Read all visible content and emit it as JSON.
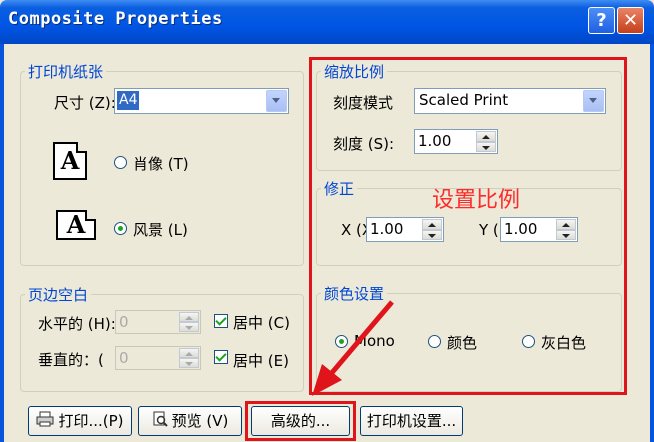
{
  "window": {
    "title": "Composite Properties",
    "help_label": "?",
    "close_label": "✕"
  },
  "paper": {
    "legend": "打印机纸张",
    "size_label": "尺寸 (Z):",
    "size_value": "A4",
    "portrait_label": "肖像 (T)",
    "landscape_label": "风景 (L)",
    "page_letter": "A",
    "selected_orientation": "landscape"
  },
  "margins": {
    "legend": "页边空白",
    "horizontal_label": "水平的 (H):",
    "horizontal_value": "0",
    "vertical_label": "垂直的：(",
    "vertical_value": "0",
    "center_h_label": "居中 (C)",
    "center_v_label": "居中 (E)",
    "center_h_checked": true,
    "center_v_checked": true
  },
  "scale": {
    "legend": "缩放比例",
    "mode_label": "刻度模式",
    "mode_value": "Scaled Print",
    "scale_label": "刻度 (S):",
    "scale_value": "1.00"
  },
  "correction": {
    "legend": "修正",
    "x_label": "X (X",
    "x_value": "1.00",
    "y_label": "Y (",
    "y_value": "1.00"
  },
  "color": {
    "legend": "颜色设置",
    "options": [
      "Mono",
      "颜色",
      "灰白色"
    ],
    "selected": "Mono"
  },
  "buttons": {
    "print": "打印...(P)",
    "preview": "预览 (V)",
    "advanced": "高级的...",
    "printer_setup": "打印机设置..."
  },
  "annotation": {
    "text": "设置比例",
    "color": "#e0141b"
  }
}
